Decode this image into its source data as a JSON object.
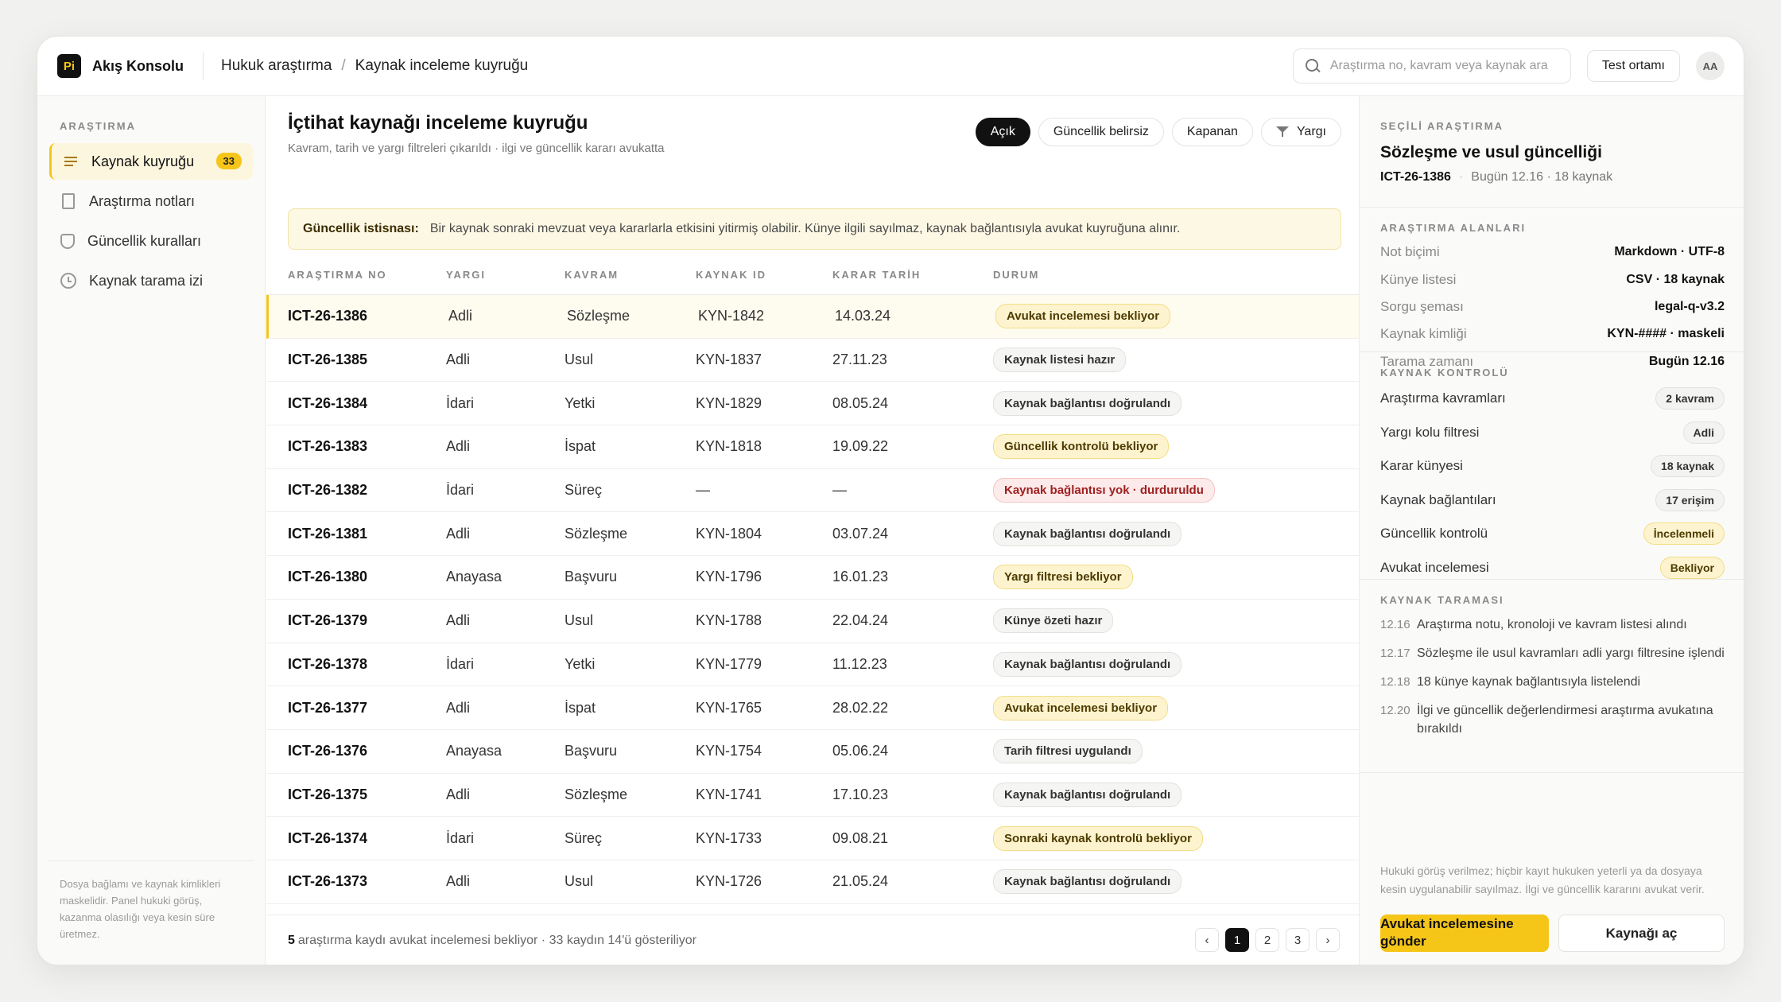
{
  "app": {
    "logo": "Pi",
    "name": "Akış Konsolu",
    "breadcrumb": [
      "Hukuk araştırma",
      "Kaynak inceleme kuyruğu"
    ],
    "search_placeholder": "Araştırma no, kavram veya kaynak ara",
    "env_label": "Test ortamı",
    "avatar": "AA"
  },
  "sidebar": {
    "title": "ARAŞTIRMA",
    "items": [
      {
        "label": "Kaynak kuyruğu",
        "icon": "list-icon",
        "badge": "33",
        "active": true
      },
      {
        "label": "Araştırma notları",
        "icon": "document-icon"
      },
      {
        "label": "Güncellik kuralları",
        "icon": "shield-icon"
      },
      {
        "label": "Kaynak tarama izi",
        "icon": "clock-icon"
      }
    ],
    "footer": "Dosya bağlamı ve kaynak kimlikleri maskelidir. Panel hukuki görüş, kazanma olasılığı veya kesin süre üretmez."
  },
  "main": {
    "title": "İçtihat kaynağı inceleme kuyruğu",
    "subtitle": "Kavram, tarih ve yargı filtreleri çıkarıldı · ilgi ve güncellik kararı avukatta",
    "filters": [
      "Açık",
      "Güncellik belirsiz",
      "Kapanan",
      "Yargı"
    ],
    "notice_label": "Güncellik istisnası:",
    "notice_text": "Bir kaynak sonraki mevzuat veya kararlarla etkisini yitirmiş olabilir. Künye ilgili sayılmaz, kaynak bağlantısıyla avukat kuyruğuna alınır.",
    "columns": [
      "ARAŞTIRMA NO",
      "YARGI",
      "KAVRAM",
      "KAYNAK ID",
      "KARAR TARİH",
      "DURUM"
    ],
    "rows": [
      {
        "id": "ICT-26-1386",
        "yargi": "Adli",
        "kavram": "Sözleşme",
        "kaynak": "KYN-1842",
        "tarih": "14.03.24",
        "durum": "Avukat incelemesi bekliyor",
        "tone": "warn"
      },
      {
        "id": "ICT-26-1385",
        "yargi": "Adli",
        "kavram": "Usul",
        "kaynak": "KYN-1837",
        "tarih": "27.11.23",
        "durum": "Kaynak listesi hazır",
        "tone": "neutral"
      },
      {
        "id": "ICT-26-1384",
        "yargi": "İdari",
        "kavram": "Yetki",
        "kaynak": "KYN-1829",
        "tarih": "08.05.24",
        "durum": "Kaynak bağlantısı doğrulandı",
        "tone": "neutral"
      },
      {
        "id": "ICT-26-1383",
        "yargi": "Adli",
        "kavram": "İspat",
        "kaynak": "KYN-1818",
        "tarih": "19.09.22",
        "durum": "Güncellik kontrolü bekliyor",
        "tone": "warn"
      },
      {
        "id": "ICT-26-1382",
        "yargi": "İdari",
        "kavram": "Süreç",
        "kaynak": "—",
        "tarih": "—",
        "durum": "Kaynak bağlantısı yok · durduruldu",
        "tone": "danger"
      },
      {
        "id": "ICT-26-1381",
        "yargi": "Adli",
        "kavram": "Sözleşme",
        "kaynak": "KYN-1804",
        "tarih": "03.07.24",
        "durum": "Kaynak bağlantısı doğrulandı",
        "tone": "neutral"
      },
      {
        "id": "ICT-26-1380",
        "yargi": "Anayasa",
        "kavram": "Başvuru",
        "kaynak": "KYN-1796",
        "tarih": "16.01.23",
        "durum": "Yargı filtresi bekliyor",
        "tone": "warn"
      },
      {
        "id": "ICT-26-1379",
        "yargi": "Adli",
        "kavram": "Usul",
        "kaynak": "KYN-1788",
        "tarih": "22.04.24",
        "durum": "Künye özeti hazır",
        "tone": "neutral"
      },
      {
        "id": "ICT-26-1378",
        "yargi": "İdari",
        "kavram": "Yetki",
        "kaynak": "KYN-1779",
        "tarih": "11.12.23",
        "durum": "Kaynak bağlantısı doğrulandı",
        "tone": "neutral"
      },
      {
        "id": "ICT-26-1377",
        "yargi": "Adli",
        "kavram": "İspat",
        "kaynak": "KYN-1765",
        "tarih": "28.02.22",
        "durum": "Avukat incelemesi bekliyor",
        "tone": "warn"
      },
      {
        "id": "ICT-26-1376",
        "yargi": "Anayasa",
        "kavram": "Başvuru",
        "kaynak": "KYN-1754",
        "tarih": "05.06.24",
        "durum": "Tarih filtresi uygulandı",
        "tone": "neutral"
      },
      {
        "id": "ICT-26-1375",
        "yargi": "Adli",
        "kavram": "Sözleşme",
        "kaynak": "KYN-1741",
        "tarih": "17.10.23",
        "durum": "Kaynak bağlantısı doğrulandı",
        "tone": "neutral"
      },
      {
        "id": "ICT-26-1374",
        "yargi": "İdari",
        "kavram": "Süreç",
        "kaynak": "KYN-1733",
        "tarih": "09.08.21",
        "durum": "Sonraki kaynak kontrolü bekliyor",
        "tone": "warn"
      },
      {
        "id": "ICT-26-1373",
        "yargi": "Adli",
        "kavram": "Usul",
        "kaynak": "KYN-1726",
        "tarih": "21.05.24",
        "durum": "Kaynak bağlantısı doğrulandı",
        "tone": "neutral"
      }
    ],
    "footer_count": "5",
    "footer_text": "araştırma kaydı avukat incelemesi bekliyor · 33 kaydın 14'ü gösteriliyor",
    "pages": [
      "‹",
      "1",
      "2",
      "3",
      "›"
    ],
    "current_page": "1"
  },
  "panel": {
    "selected_label": "SEÇİLİ ARAŞTIRMA",
    "selected_title": "Sözleşme ve usul güncelliği",
    "selected_id": "ICT-26-1386",
    "selected_meta": "Bugün 12.16 · 18 kaynak",
    "fields_label": "ARAŞTIRMA ALANLARI",
    "fields": [
      {
        "k": "Not biçimi",
        "v": "Markdown · UTF-8"
      },
      {
        "k": "Künye listesi",
        "v": "CSV · 18 kaynak"
      },
      {
        "k": "Sorgu şeması",
        "v": "legal-q-v3.2"
      },
      {
        "k": "Kaynak kimliği",
        "v": "KYN-#### · maskeli"
      },
      {
        "k": "Tarama zamanı",
        "v": "Bugün 12.16"
      }
    ],
    "checks_label": "KAYNAK KONTROLÜ",
    "checks": [
      {
        "k": "Araştırma kavramları",
        "v": "2 kavram",
        "tone": "neutral"
      },
      {
        "k": "Yargı kolu filtresi",
        "v": "Adli",
        "tone": "neutral"
      },
      {
        "k": "Karar künyesi",
        "v": "18 kaynak",
        "tone": "neutral"
      },
      {
        "k": "Kaynak bağlantıları",
        "v": "17 erişim",
        "tone": "neutral"
      },
      {
        "k": "Güncellik kontrolü",
        "v": "İncelenmeli",
        "tone": "warn"
      },
      {
        "k": "Avukat incelemesi",
        "v": "Bekliyor",
        "tone": "warn"
      }
    ],
    "scan_label": "KAYNAK TARAMASI",
    "scan": [
      {
        "t": "12.16",
        "text": "Araştırma notu, kronoloji ve kavram listesi alındı"
      },
      {
        "t": "12.17",
        "text": "Sözleşme ile usul kavramları adli yargı filtresine işlendi"
      },
      {
        "t": "12.18",
        "text": "18 künye kaynak bağlantısıyla listelendi"
      },
      {
        "t": "12.20",
        "text": "İlgi ve güncellik değerlendirmesi araştırma avukatına bırakıldı"
      }
    ],
    "disclaimer": "Hukuki görüş verilmez; hiçbir kayıt hukuken yeterli ya da dosyaya kesin uygulanabilir sayılmaz. İlgi ve güncellik kararını avukat verir.",
    "primary_action": "Avukat incelemesine gönder",
    "secondary_action": "Kaynağı aç"
  }
}
